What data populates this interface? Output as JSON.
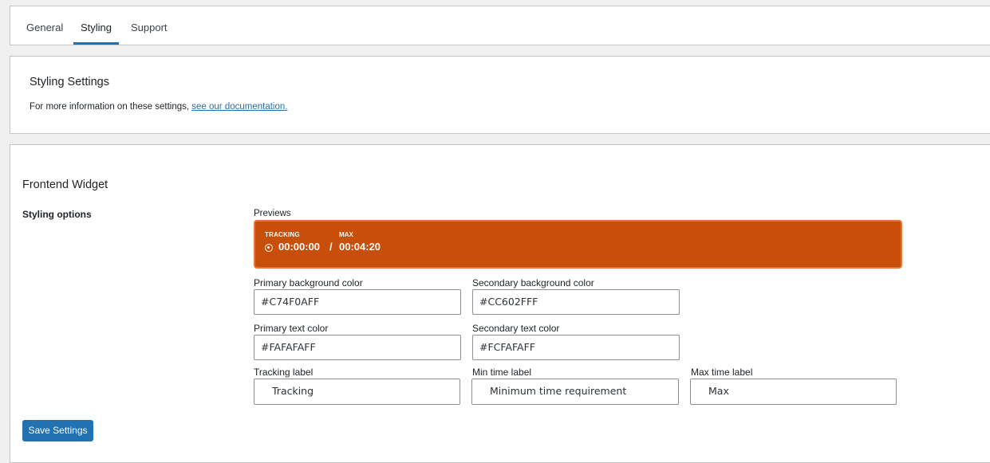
{
  "tabs": [
    {
      "label": "General",
      "active": false
    },
    {
      "label": "Styling",
      "active": true
    },
    {
      "label": "Support",
      "active": false
    }
  ],
  "info": {
    "title": "Styling Settings",
    "text": "For more information on these settings, ",
    "link_text": "see our documentation."
  },
  "widget": {
    "section_title": "Frontend Widget",
    "row_label": "Styling options",
    "previews_label": "Previews",
    "preview": {
      "tracking_label": "TRACKING",
      "max_label": "MAX",
      "current_time": "00:00:00",
      "separator": "/",
      "max_time": "00:04:20"
    },
    "fields": {
      "primary_bg": {
        "label": "Primary background color",
        "value": "#C74F0AFF"
      },
      "secondary_bg": {
        "label": "Secondary background color",
        "value": "#CC602FFF"
      },
      "primary_text": {
        "label": "Primary text color",
        "value": "#FAFAFAFF"
      },
      "secondary_text": {
        "label": "Secondary text color",
        "value": "#FCFAFAFF"
      },
      "tracking_label": {
        "label": "Tracking label",
        "value": "Tracking"
      },
      "min_time_label": {
        "label": "Min time label",
        "value": "Minimum time requirement"
      },
      "max_time_label": {
        "label": "Max time label",
        "value": "Max"
      }
    },
    "save_label": "Save Settings"
  },
  "colors": {
    "accent": "#2271b1",
    "preview_bg": "#C74F0A",
    "preview_text": "#FAFAFA"
  }
}
